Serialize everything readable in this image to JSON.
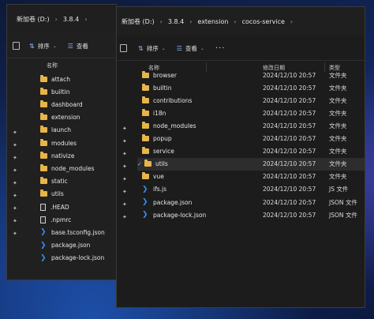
{
  "back_window": {
    "breadcrumb": [
      "新加卷 (D:)",
      "3.8.4"
    ],
    "breadcrumb_more": "›",
    "toolbar": {
      "sort_label": "排序",
      "view_label": "查看"
    },
    "column_name": "名称",
    "items": [
      {
        "name": "attach",
        "kind": "folder"
      },
      {
        "name": "builtin",
        "kind": "folder"
      },
      {
        "name": "dashboard",
        "kind": "folder"
      },
      {
        "name": "extension",
        "kind": "folder"
      },
      {
        "name": "launch",
        "kind": "folder"
      },
      {
        "name": "modules",
        "kind": "folder"
      },
      {
        "name": "nativize",
        "kind": "folder"
      },
      {
        "name": "node_modules",
        "kind": "folder"
      },
      {
        "name": "static",
        "kind": "folder"
      },
      {
        "name": "utils",
        "kind": "folder"
      },
      {
        "name": ".HEAD",
        "kind": "file"
      },
      {
        "name": ".npmrc",
        "kind": "file"
      },
      {
        "name": "base.tsconfig.json",
        "kind": "vscode"
      },
      {
        "name": "package.json",
        "kind": "vscode"
      },
      {
        "name": "package-lock.json",
        "kind": "vscode"
      }
    ]
  },
  "front_window": {
    "breadcrumb": [
      "新加卷 (D:)",
      "3.8.4",
      "extension",
      "cocos-service"
    ],
    "toolbar": {
      "sort_label": "排序",
      "view_label": "查看",
      "more_label": "···"
    },
    "columns": {
      "name": "名称",
      "date": "修改日期",
      "type": "类型"
    },
    "items": [
      {
        "name": "browser",
        "kind": "folder",
        "date": "2024/12/10 20:57",
        "type": "文件夹"
      },
      {
        "name": "builtin",
        "kind": "folder",
        "date": "2024/12/10 20:57",
        "type": "文件夹"
      },
      {
        "name": "contributions",
        "kind": "folder",
        "date": "2024/12/10 20:57",
        "type": "文件夹"
      },
      {
        "name": "i18n",
        "kind": "folder",
        "date": "2024/12/10 20:57",
        "type": "文件夹"
      },
      {
        "name": "node_modules",
        "kind": "folder",
        "date": "2024/12/10 20:57",
        "type": "文件夹"
      },
      {
        "name": "popup",
        "kind": "folder",
        "date": "2024/12/10 20:57",
        "type": "文件夹"
      },
      {
        "name": "service",
        "kind": "folder",
        "date": "2024/12/10 20:57",
        "type": "文件夹"
      },
      {
        "name": "utils",
        "kind": "folder",
        "date": "2024/12/10 20:57",
        "type": "文件夹",
        "selected": true
      },
      {
        "name": "vue",
        "kind": "folder",
        "date": "2024/12/10 20:57",
        "type": "文件夹"
      },
      {
        "name": "ifs.js",
        "kind": "vscode",
        "date": "2024/12/10 20:57",
        "type": "JS 文件"
      },
      {
        "name": "package.json",
        "kind": "vscode",
        "date": "2024/12/10 20:57",
        "type": "JSON 文件"
      },
      {
        "name": "package-lock.json",
        "kind": "vscode",
        "date": "2024/12/10 20:57",
        "type": "JSON 文件"
      }
    ]
  },
  "colors": {
    "folder": "#e8b54a",
    "vscode": "#3b8ee8",
    "accent": "#8ab4f8"
  }
}
